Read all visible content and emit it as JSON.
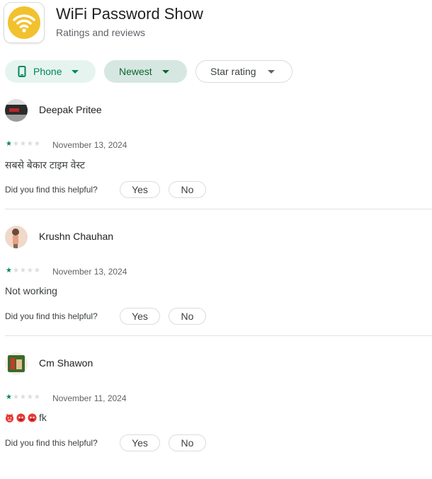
{
  "app": {
    "title": "WiFi Password Show",
    "subtitle": "Ratings and reviews",
    "icon": "wifi-icon",
    "icon_color": "#f2c12e"
  },
  "filters": {
    "device": "Phone",
    "sort": "Newest",
    "rating": "Star rating"
  },
  "helpful_prompt": "Did you find this helpful?",
  "helpful_yes": "Yes",
  "helpful_no": "No",
  "reviews": [
    {
      "author": "Deepak Pritee",
      "rating": 1,
      "max_rating": 5,
      "date": "November 13, 2024",
      "text": "सबसे बेकार टाइम वेस्ट"
    },
    {
      "author": "Krushn Chauhan",
      "rating": 1,
      "max_rating": 5,
      "date": "November 13, 2024",
      "text": "Not working"
    },
    {
      "author": "Cm Shawon",
      "rating": 1,
      "max_rating": 5,
      "date": "November 11, 2024",
      "text": "fk",
      "emojis": [
        "angry-devil-emoji",
        "angry-face-emoji",
        "angry-face-emoji"
      ]
    }
  ],
  "colors": {
    "accent": "#01875f",
    "phone_chip_bg": "#e6f4ef",
    "newest_chip_bg": "#d6e7e1",
    "star_off": "#dadce0"
  }
}
